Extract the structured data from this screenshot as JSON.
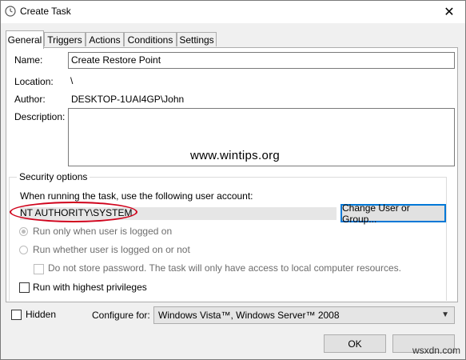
{
  "window": {
    "title": "Create Task",
    "close_glyph": "✕"
  },
  "tabs": [
    {
      "label": "General",
      "active": true
    },
    {
      "label": "Triggers",
      "active": false
    },
    {
      "label": "Actions",
      "active": false
    },
    {
      "label": "Conditions",
      "active": false
    },
    {
      "label": "Settings",
      "active": false
    }
  ],
  "general": {
    "name_label": "Name:",
    "name_value": "Create Restore Point",
    "location_label": "Location:",
    "location_value": "\\",
    "author_label": "Author:",
    "author_value": "DESKTOP-1UAI4GP\\John",
    "description_label": "Description:",
    "description_value": ""
  },
  "security": {
    "group_label": "Security options",
    "account_prompt": "When running the task, use the following user account:",
    "account_value": "NT AUTHORITY\\SYSTEM",
    "change_button": "Change User or Group...",
    "radio_logged_on": "Run only when user is logged on",
    "radio_logged_on_checked": true,
    "radio_whether": "Run whether user is logged on or not",
    "no_store_password": "Do not store password.  The task will only have access to local computer resources.",
    "highest_privileges": "Run with highest privileges"
  },
  "footer": {
    "hidden_label": "Hidden",
    "configure_label": "Configure for:",
    "configure_value": "Windows Vista™, Windows Server™ 2008",
    "ok_button": "OK"
  },
  "watermarks": {
    "center": "www.wintips.org",
    "corner": "wsxdn.com"
  },
  "colors": {
    "accent": "#0078d7",
    "highlight": "#d0021b"
  }
}
